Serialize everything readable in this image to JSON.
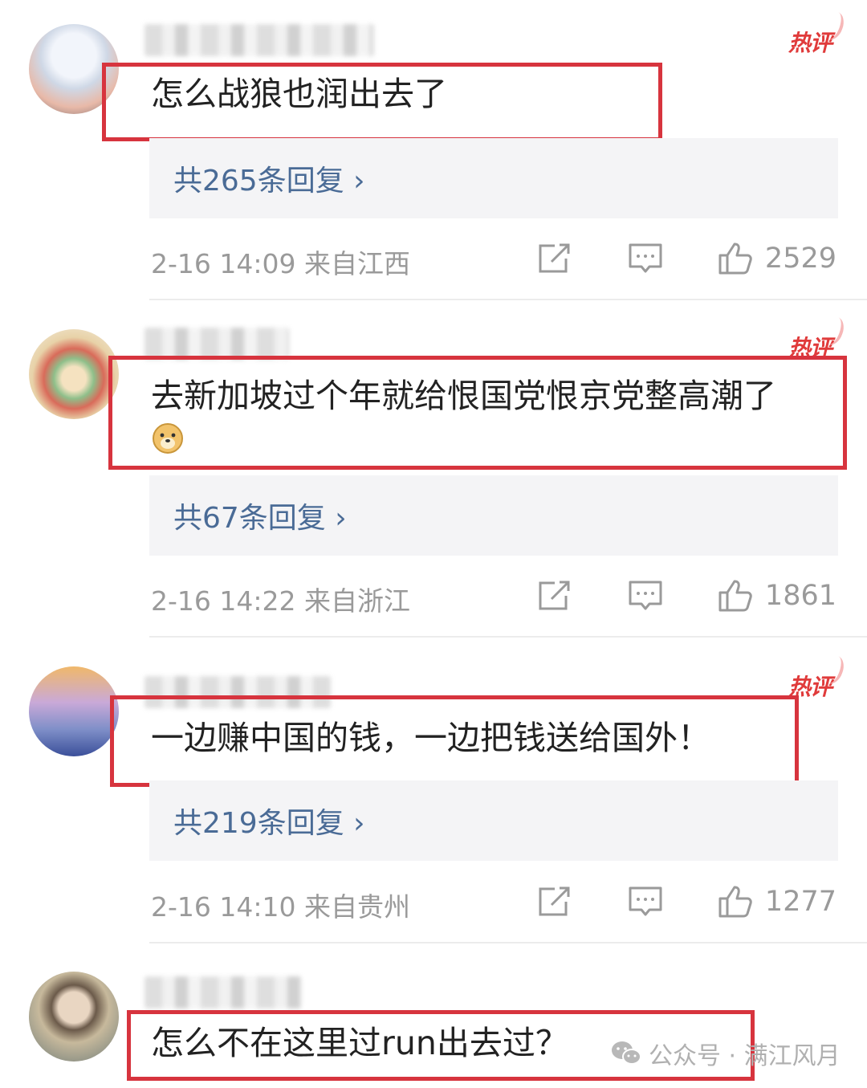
{
  "hot_label": "热评",
  "comments": [
    {
      "text": "怎么战狼也润出去了",
      "emoji": "",
      "replies": "共265条回复 ›",
      "time_location": "2-16 14:09  来自江西",
      "likes": "2529"
    },
    {
      "text": "去新加坡过个年就给恨国党恨京党整高潮了",
      "emoji": "doge-emoji",
      "replies": "共67条回复 ›",
      "time_location": "2-16 14:22  来自浙江",
      "likes": "1861"
    },
    {
      "text": "一边赚中国的钱，一边把钱送给国外！",
      "emoji": "",
      "replies": "共219条回复 ›",
      "time_location": "2-16 14:10  来自贵州",
      "likes": "1277"
    },
    {
      "text": "怎么不在这里过run出去过？",
      "emoji": "",
      "replies": "",
      "time_location": "",
      "likes": ""
    }
  ],
  "watermark": {
    "text": "公众号 · 满江风月",
    "icon": "wechat-icon"
  },
  "colors": {
    "highlight_border": "#d7343e",
    "reply_link": "#4a6b96",
    "meta_text": "#9a9a9a",
    "hot_badge": "#e03b3b"
  }
}
